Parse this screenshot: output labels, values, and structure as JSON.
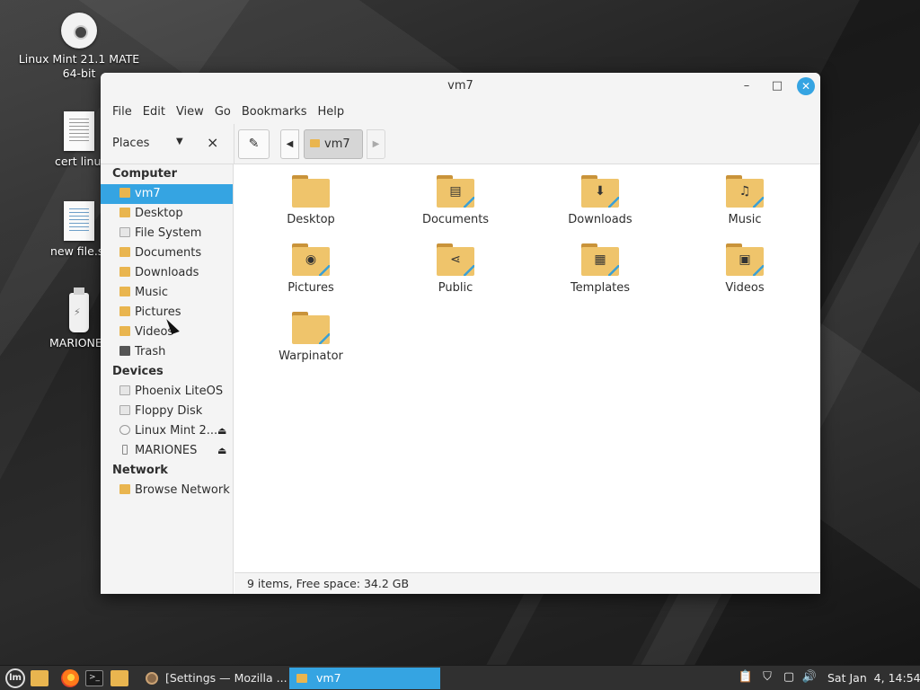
{
  "desktop": {
    "icons": [
      {
        "name": "desk-icon-linux-mint-disc",
        "label": "Linux Mint 21.1 MATE 64-bit"
      },
      {
        "name": "desk-icon-cert",
        "label": "cert linu"
      },
      {
        "name": "desk-icon-new-file",
        "label": "new file.s"
      },
      {
        "name": "desk-icon-mariones",
        "label": "MARIONE"
      }
    ]
  },
  "window": {
    "title": "vm7",
    "controls": {
      "minimize": "–",
      "maximize": "□",
      "close": "✕"
    }
  },
  "menubar": [
    "File",
    "Edit",
    "Go",
    "Bookmarks",
    "Help"
  ],
  "menubar_view": "View",
  "toolbar": {
    "places_label": "Places",
    "edit_icon": "✎",
    "back_icon": "◀",
    "forward_icon": "▶",
    "breadcrumb": "vm7"
  },
  "sidebar": {
    "computer_heading": "Computer",
    "computer": [
      {
        "label": "vm7",
        "icon": "home-folder-icon"
      },
      {
        "label": "Desktop",
        "icon": "folder-icon"
      },
      {
        "label": "File System",
        "icon": "drive-icon"
      },
      {
        "label": "Documents",
        "icon": "documents-folder-icon"
      },
      {
        "label": "Downloads",
        "icon": "downloads-folder-icon"
      },
      {
        "label": "Music",
        "icon": "music-folder-icon"
      },
      {
        "label": "Pictures",
        "icon": "pictures-folder-icon"
      },
      {
        "label": "Videos",
        "icon": "videos-folder-icon"
      },
      {
        "label": "Trash",
        "icon": "trash-icon"
      }
    ],
    "devices_heading": "Devices",
    "devices": [
      {
        "label": "Phoenix LiteOS",
        "icon": "drive-icon"
      },
      {
        "label": "Floppy Disk",
        "icon": "floppy-icon"
      },
      {
        "label": "Linux Mint 2...",
        "icon": "optical-disc-icon"
      },
      {
        "label": "MARIONES",
        "icon": "usb-drive-icon"
      }
    ],
    "network_heading": "Network",
    "network": [
      {
        "label": "Browse Network",
        "icon": "network-folder-icon"
      }
    ]
  },
  "files": [
    {
      "label": "Desktop",
      "emblem": ""
    },
    {
      "label": "Documents",
      "emblem": "▤"
    },
    {
      "label": "Downloads",
      "emblem": "⬇"
    },
    {
      "label": "Music",
      "emblem": "♫"
    },
    {
      "label": "Pictures",
      "emblem": "◉"
    },
    {
      "label": "Public",
      "emblem": "⋖"
    },
    {
      "label": "Templates",
      "emblem": "▦"
    },
    {
      "label": "Videos",
      "emblem": "▣"
    },
    {
      "label": "Warpinator",
      "emblem": ""
    }
  ],
  "statusbar": "9 items, Free space: 34.2 GB",
  "taskbar": {
    "menu_glyph": "lm",
    "terminal_glyph": ">_",
    "windows": [
      "[Settings — Mozilla ...",
      "vm7"
    ],
    "clock": "Sat Jan  4, 14:54"
  },
  "colors": {
    "accent": "#35a4e2",
    "folder": "#efc46b",
    "panel": "#303030"
  }
}
